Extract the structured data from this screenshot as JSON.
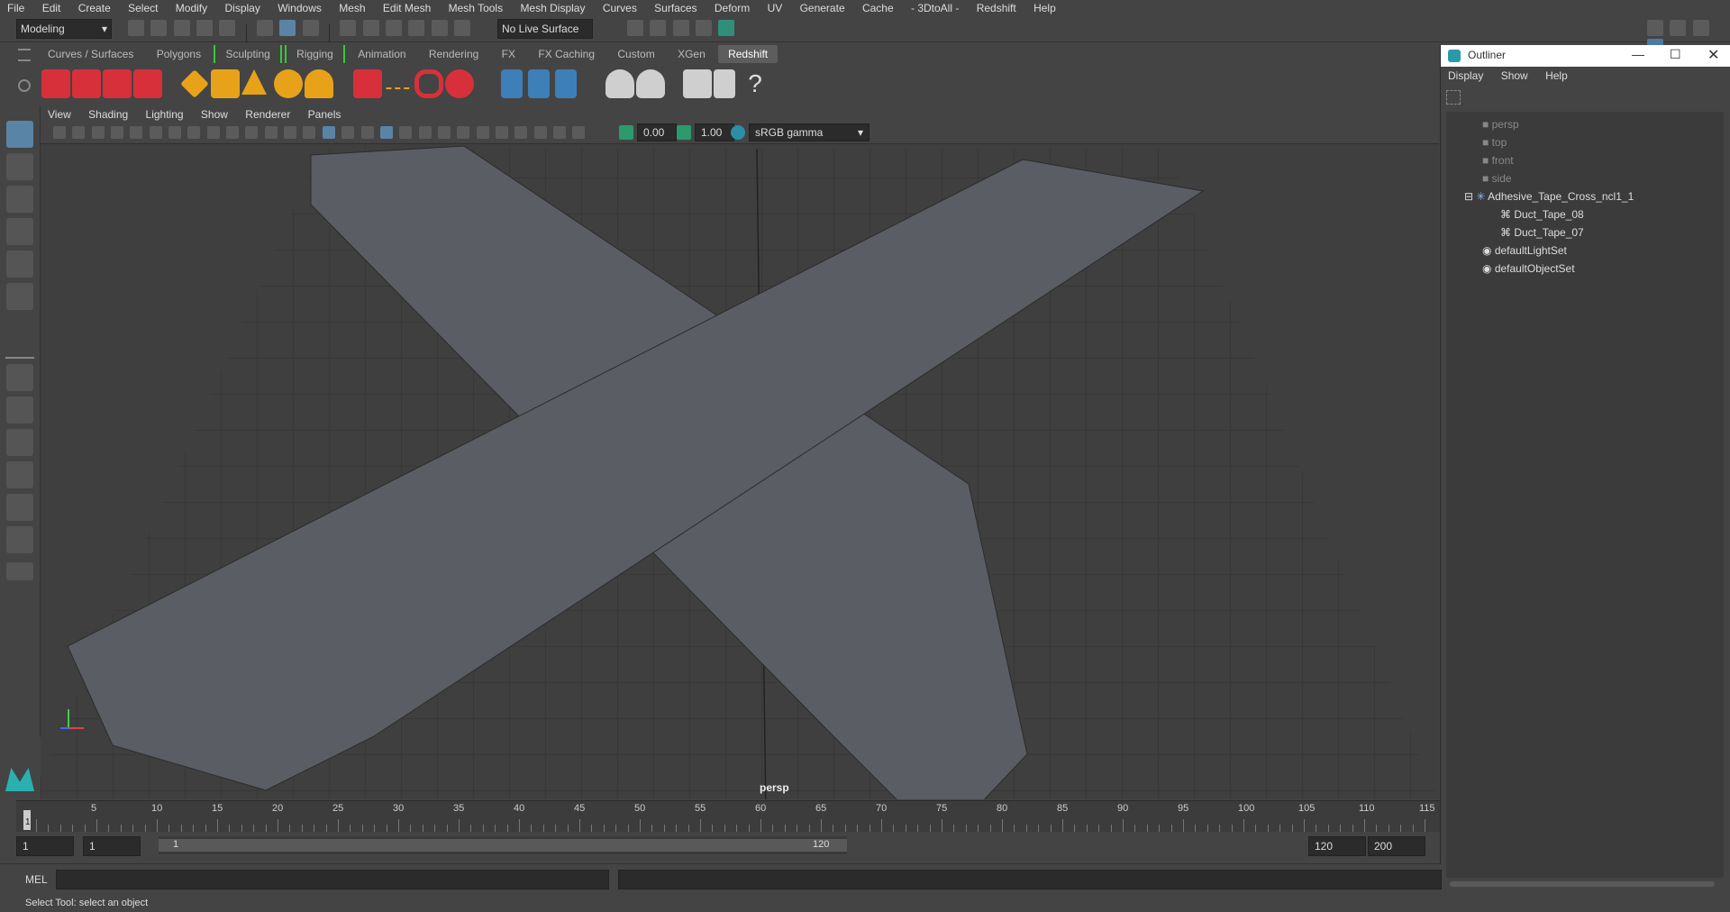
{
  "menubar": {
    "items": [
      "File",
      "Edit",
      "Create",
      "Select",
      "Modify",
      "Display",
      "Windows",
      "Mesh",
      "Edit Mesh",
      "Mesh Tools",
      "Mesh Display",
      "Curves",
      "Surfaces",
      "Deform",
      "UV",
      "Generate",
      "Cache",
      "- 3DtoAll -",
      "Redshift",
      "Help"
    ]
  },
  "status": {
    "mode": "Modeling",
    "live_surface": "No Live Surface"
  },
  "shelf_tabs": [
    "Curves / Surfaces",
    "Polygons",
    "Sculpting",
    "Rigging",
    "Animation",
    "Rendering",
    "FX",
    "FX Caching",
    "Custom",
    "XGen",
    "Redshift"
  ],
  "shelf_active": "Redshift",
  "panel_menu": [
    "View",
    "Shading",
    "Lighting",
    "Show",
    "Renderer",
    "Panels"
  ],
  "panel_tools": {
    "exposure": "0.00",
    "gamma": "1.00",
    "colorspace": "sRGB gamma"
  },
  "viewport": {
    "camera_label": "persp"
  },
  "outliner": {
    "title": "Outliner",
    "menu": [
      "Display",
      "Show",
      "Help"
    ],
    "items": [
      "persp",
      "top",
      "front",
      "side",
      "Adhesive_Tape_Cross_ncl1_1",
      "Duct_Tape_08",
      "Duct_Tape_07",
      "defaultLightSet",
      "defaultObjectSet"
    ]
  },
  "timeline": {
    "ticks": [
      "5",
      "10",
      "15",
      "20",
      "25",
      "30",
      "35",
      "40",
      "45",
      "50",
      "55",
      "60",
      "65",
      "70",
      "75",
      "80",
      "85",
      "90",
      "95",
      "100",
      "105",
      "110",
      "115"
    ],
    "current": "1"
  },
  "range": {
    "start": "1",
    "playback_start": "1",
    "slider_start": "1",
    "slider_end": "120",
    "playback_end": "120",
    "end": "200"
  },
  "cmdline": {
    "label": "MEL"
  },
  "helpline": {
    "text": "Select Tool: select an object"
  }
}
